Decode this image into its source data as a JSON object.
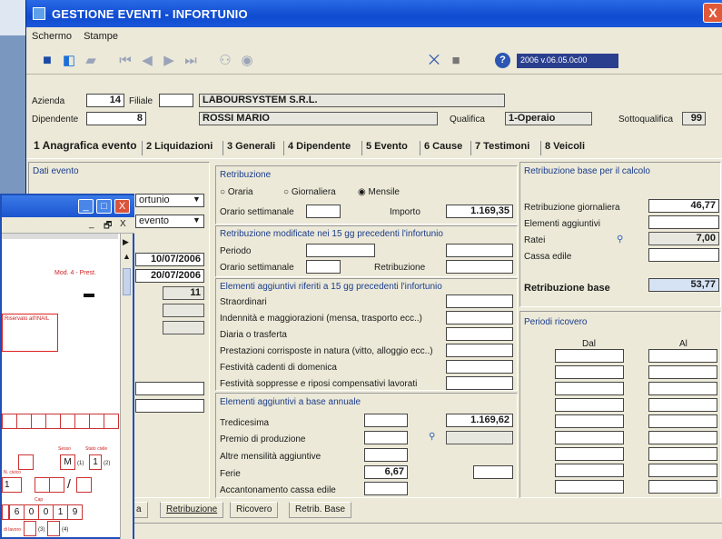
{
  "window": {
    "title": "GESTIONE EVENTI - INFORTUNIO",
    "close_glyph": "X",
    "menu": [
      {
        "label": "Schermo"
      },
      {
        "label": "Stampe"
      }
    ],
    "version": "2006 v.06.05.0c00"
  },
  "header": {
    "azienda_label": "Azienda",
    "azienda_value": "14",
    "filiale_label": "Filiale",
    "filiale_value": "",
    "company": "LABOURSYSTEM S.R.L.",
    "dipendente_label": "Dipendente",
    "dipendente_value": "8",
    "employee": "ROSSI MARIO",
    "qualifica_label": "Qualifica",
    "qualifica_value": "1-Operaio",
    "sottoqualifica_label": "Sottoqualifica",
    "sottoqualifica_value": "99"
  },
  "tabs": [
    {
      "label": "1 Anagrafica evento"
    },
    {
      "label": "2 Liquidazioni"
    },
    {
      "label": "3 Generali"
    },
    {
      "label": "4 Dipendente"
    },
    {
      "label": "5 Evento"
    },
    {
      "label": "6 Cause"
    },
    {
      "label": "7 Testimoni"
    },
    {
      "label": "8 Veicoli"
    }
  ],
  "dati_evento": {
    "title": "Dati evento",
    "select1": "ortunio",
    "select2": "evento",
    "date1": "10/07/2006",
    "date2": "20/07/2006",
    "num": "11"
  },
  "retribuzione": {
    "title": "Retribuzione",
    "radio_oraria": "Oraria",
    "radio_giornaliera": "Giornaliera",
    "radio_mensile": "Mensile",
    "orario_label": "Orario settimanale",
    "importo_label": "Importo",
    "importo_value": "1.169,35"
  },
  "modificate": {
    "title": "Retribuzione modificate nei 15 gg precedenti l'infortunio",
    "periodo_label": "Periodo",
    "orario_label": "Orario settimanale",
    "retribuzione_label": "Retribuzione"
  },
  "aggiuntivi15": {
    "title": "Elementi aggiuntivi riferiti a 15 gg precedenti l'infortunio",
    "items": [
      {
        "label": "Straordinari"
      },
      {
        "label": "Indennità e maggiorazioni (mensa, trasporto ecc..)"
      },
      {
        "label": "Diaria o trasferta"
      },
      {
        "label": "Prestazioni corrisposte in natura (vitto, alloggio ecc..)"
      },
      {
        "label": "Festività cadenti di domenica"
      },
      {
        "label": "Festività soppresse e riposi compensativi lavorati"
      }
    ]
  },
  "annuali": {
    "title": "Elementi aggiuntivi a base annuale",
    "tredicesima_label": "Tredicesima",
    "tredicesima_value": "1.169,62",
    "premio_label": "Premio di produzione",
    "altre_label": "Altre mensilità aggiuntive",
    "ferie_label": "Ferie",
    "ferie_value": "6,67",
    "accantonamento_label": "Accantonamento cassa edile"
  },
  "base": {
    "title": "Retribuzione base per il calcolo",
    "giornaliera_label": "Retribuzione giornaliera",
    "giornaliera_value": "46,77",
    "elementi_label": "Elementi aggiuntivi",
    "ratei_label": "Ratei",
    "ratei_value": "7,00",
    "cassa_label": "Cassa edile",
    "base_label": "Retribuzione base",
    "base_value": "53,77"
  },
  "ricovero": {
    "title": "Periodi ricovero",
    "dal_label": "Dal",
    "al_label": "Al"
  },
  "bottom_tabs": [
    {
      "label": "a"
    },
    {
      "label": "Retribuzione"
    },
    {
      "label": "Ricovero"
    },
    {
      "label": "Retrib. Base"
    }
  ],
  "overlay": {
    "mod_label": "Mod. 4 - Prest.",
    "riservato": "Riservato all'INAIL",
    "sesso_label": "Sesso",
    "stato_label": "Stato civile",
    "sesso_value": "M",
    "stato_value": "1",
    "civico_label": "N. civico",
    "civico_value": "1",
    "cap_label": "Cap",
    "cap_digits": [
      "6",
      "0",
      "0",
      "1",
      "9"
    ],
    "slash": "/",
    "sub1": "(1)",
    "sub2": "(2)",
    "sub3": "(3)",
    "sub4": "(4)",
    "lavoro_label": "di lavoro",
    "min_glyph": "_",
    "max_glyph": "□",
    "close_glyph": "X",
    "inner_min": "_",
    "inner_restore": "🗗",
    "inner_close": "X"
  }
}
